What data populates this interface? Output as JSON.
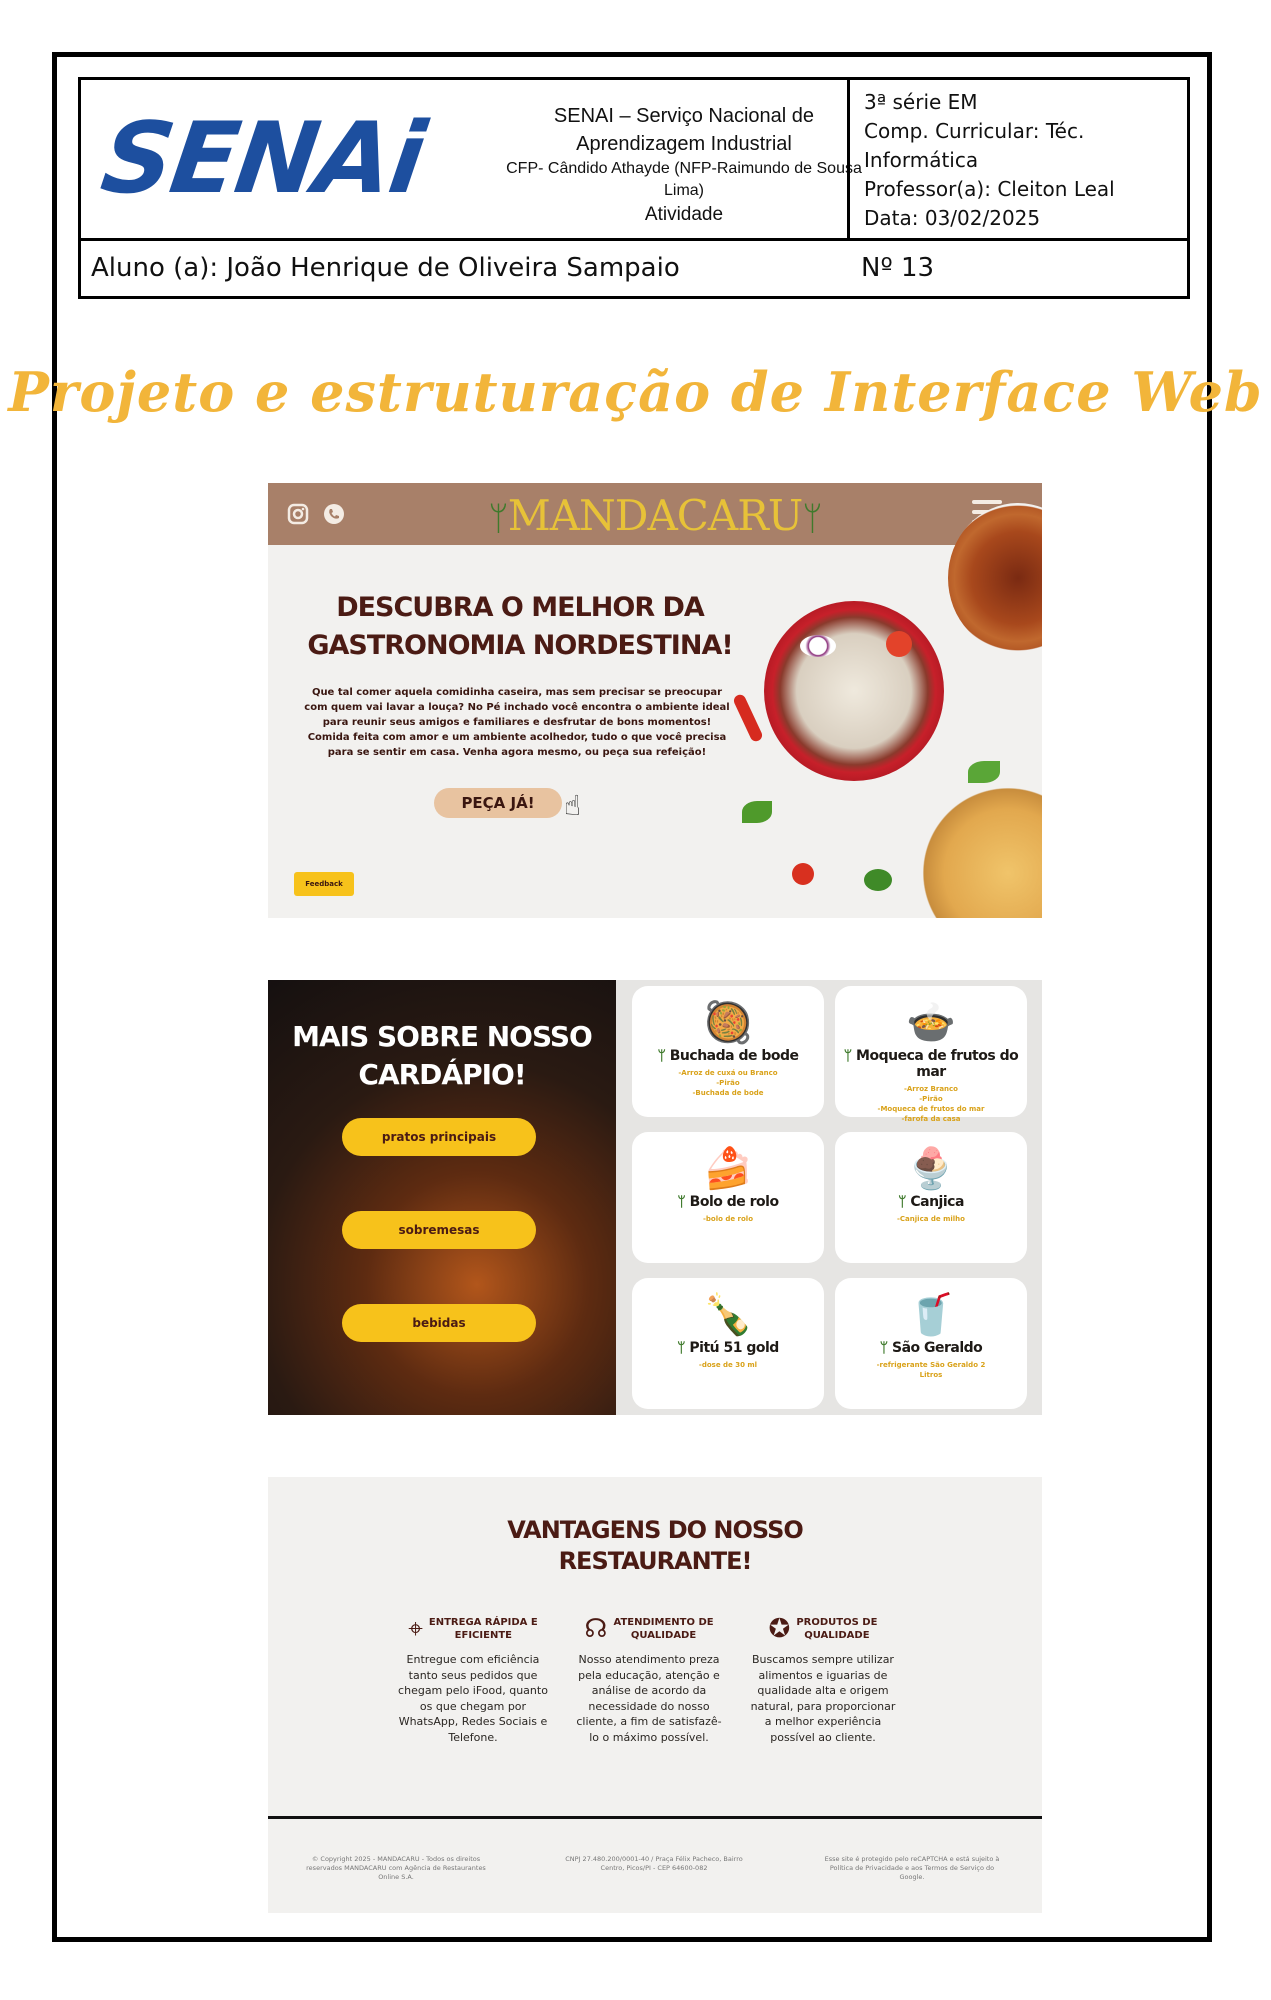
{
  "header": {
    "logo_text": "SENAi",
    "institution_line1": "SENAI – Serviço Nacional de",
    "institution_line2": "Aprendizagem Industrial",
    "institution_line3": "CFP- Cândido Athayde (NFP-Raimundo de Sousa",
    "institution_line4": "Lima)",
    "activity": "Atividade",
    "grade": "3ª série EM",
    "component_line1": "Comp. Curricular: Téc.",
    "component_line2": "Informática",
    "teacher": "Professor(a): Cleiton Leal",
    "date": "Data: 03/02/2025",
    "student": "Aluno (a): João Henrique de Oliveira Sampaio",
    "number": "Nº 13"
  },
  "title": "Projeto e estruturação de Interface Web",
  "hero": {
    "brand": "MANDACARU",
    "cactus_glyph": "ᛘ",
    "instagram_icon": "instagram-icon",
    "phone_icon": "phone-icon",
    "headline_line1": "DESCUBRA O MELHOR DA",
    "headline_line2": "GASTRONOMIA NORDESTINA!",
    "paragraph": "Que tal comer aquela comidinha caseira, mas sem precisar se preocupar com quem vai lavar a louça? No Pé inchado você encontra o ambiente ideal para reunir seus amigos e familiares e desfrutar de bons momentos! Comida feita com amor e um ambiente acolhedor, tudo o que você precisa para se sentir em casa. Venha agora mesmo, ou peça sua refeição!",
    "cta": "PEÇA JÁ!",
    "feedback": "Feedback"
  },
  "menu": {
    "heading_line1": "MAIS SOBRE NOSSO",
    "heading_line2": "CARDÁPIO!",
    "pills": [
      "pratos principais",
      "sobremesas",
      "bebidas"
    ],
    "cards": [
      {
        "name": "Buchada de bode",
        "desc": "-Arroz de cuxá ou Branco\n-Pirão\n-Buchada de bode",
        "img": "🥘"
      },
      {
        "name": "Moqueca de frutos do mar",
        "desc": "-Arroz Branco\n-Pirão\n-Moqueca de frutos do mar\n-farofa da casa",
        "img": "🍲"
      },
      {
        "name": "Bolo de rolo",
        "desc": "-bolo de rolo",
        "img": "🍰"
      },
      {
        "name": "Canjica",
        "desc": "-Canjica de milho",
        "img": "🍨"
      },
      {
        "name": "Pitú 51 gold",
        "desc": "-dose de 30 ml",
        "img": "🍾"
      },
      {
        "name": "São Geraldo",
        "desc": "-refrigerante São Geraldo 2\nLitros",
        "img": "🥤"
      }
    ]
  },
  "advantages": {
    "heading_line1": "VANTAGENS DO NOSSO",
    "heading_line2": "RESTAURANTE!",
    "items": [
      {
        "title": "ENTREGA RÁPIDA E\nEFICIENTE",
        "icon": "location-pin-icon",
        "glyph": "⌖",
        "text": "Entregue com eficiência tanto seus pedidos que chegam pelo iFood, quanto os que chegam por WhatsApp, Redes Sociais e Telefone."
      },
      {
        "title": "ATENDIMENTO DE\nQUALIDADE",
        "icon": "headset-icon",
        "glyph": "☊",
        "text": "Nosso atendimento preza pela educação, atenção e análise de acordo da necessidade do nosso cliente, a fim de satisfazê-lo o máximo possível."
      },
      {
        "title": "PRODUTOS DE\nQUALIDADE",
        "icon": "quality-badge-icon",
        "glyph": "✪",
        "text": "Buscamos sempre utilizar alimentos e iguarias de qualidade alta e origem natural, para proporcionar a melhor experiência possível ao cliente."
      }
    ],
    "footer_left": "© Copyright 2025 - MANDACARU - Todos os direitos reservados MANDACARU com Agência de Restaurantes Online S.A.",
    "footer_center": "CNPJ 27.480.200/0001-40 / Praça Félix Pacheco, Bairro Centro, Picos/PI - CEP 64600-082",
    "footer_right": "Esse site é protegido pelo reCAPTCHA e está sujeito à Política de Privacidade e aos Termos de Serviço do Google."
  },
  "colors": {
    "brand_blue": "#1d4f9f",
    "title_gold": "#f2b53a",
    "nav_brown": "#a88069",
    "accent_yellow": "#f7c21b",
    "dark_brown": "#4b1b14"
  }
}
